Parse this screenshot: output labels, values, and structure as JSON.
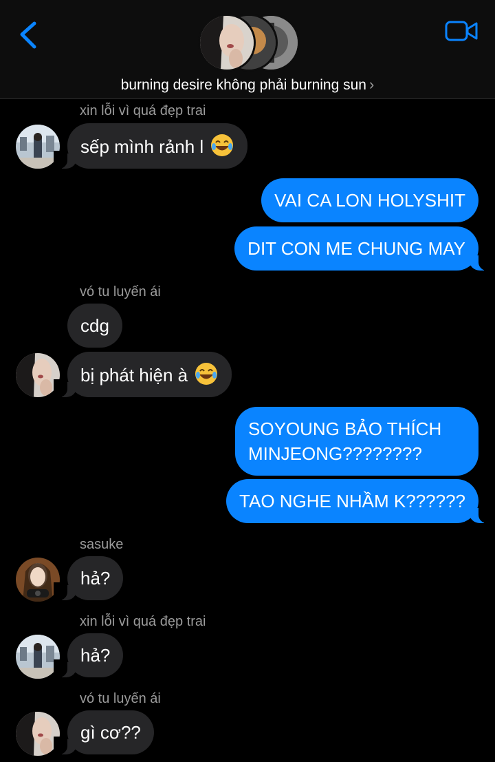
{
  "header": {
    "group_name": "burning desire không phải burning sun",
    "chevron": "›",
    "back_icon": "chevron-left-icon",
    "video_icon": "video-camera-icon",
    "accent": "#0a84ff"
  },
  "messages": {
    "m1": {
      "sender": "xin lỗi vì quá đẹp trai",
      "text": "sếp mình rảnh l",
      "emoji": "joy-emoji"
    },
    "m2": {
      "text": "VAI CA LON HOLYSHIT"
    },
    "m3": {
      "text": "DIT CON ME CHUNG MAY"
    },
    "m4": {
      "sender": "vó tu luyến ái",
      "text": "cdg"
    },
    "m5": {
      "text": "bị phát hiện à",
      "emoji": "joy-emoji"
    },
    "m6": {
      "line1": "SOYOUNG BẢO THÍCH",
      "line2": "MINJEONG????????"
    },
    "m7": {
      "text": "TAO NGHE NHẦM K??????"
    },
    "m8": {
      "sender": "sasuke",
      "text": "hả?"
    },
    "m9": {
      "sender": "xin lỗi vì quá đẹp trai",
      "text": "hả?"
    },
    "m10": {
      "sender": "vó tu luyến ái",
      "text": "gì cơ??"
    }
  },
  "colors": {
    "incoming_bubble": "#262628",
    "outgoing_bubble": "#0a84ff",
    "sender_text": "#9b9b9b",
    "background": "#000000"
  }
}
